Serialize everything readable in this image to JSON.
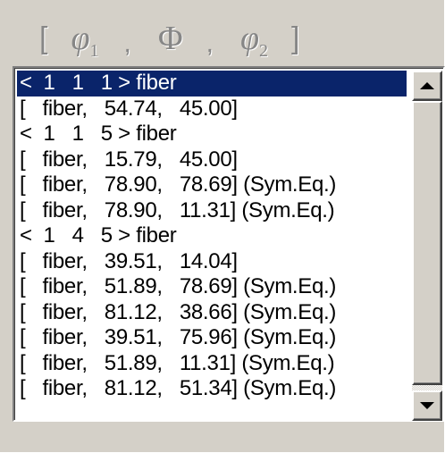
{
  "header": {
    "open_bracket": "[",
    "phi1_symbol": "φ",
    "phi1_sub": "1",
    "comma1": ",",
    "Phi_symbol": "Φ",
    "comma2": ",",
    "phi2_symbol": "φ",
    "phi2_sub": "2",
    "close_bracket": "]"
  },
  "list": {
    "selected_index": 0,
    "items": [
      "<  1   1   1 > fiber",
      "[   fiber,   54.74,   45.00]",
      "<  1   1   5 > fiber",
      "[   fiber,   15.79,   45.00]",
      "[   fiber,   78.90,   78.69] (Sym.Eq.)",
      "[   fiber,   78.90,   11.31] (Sym.Eq.)",
      "<  1   4   5 > fiber",
      "[   fiber,   39.51,   14.04]",
      "[   fiber,   51.89,   78.69] (Sym.Eq.)",
      "[   fiber,   81.12,   38.66] (Sym.Eq.)",
      "[   fiber,   39.51,   75.96] (Sym.Eq.)",
      "[   fiber,   51.89,   11.31] (Sym.Eq.)",
      "[   fiber,   81.12,   51.34] (Sym.Eq.)"
    ]
  },
  "scrollbar": {
    "up_icon": "arrow-up-icon",
    "down_icon": "arrow-down-icon"
  },
  "colors": {
    "selection_bg": "#0a246a",
    "selection_fg": "#ffffff",
    "window_bg": "#d4d0c8",
    "header_text": "#868686"
  }
}
